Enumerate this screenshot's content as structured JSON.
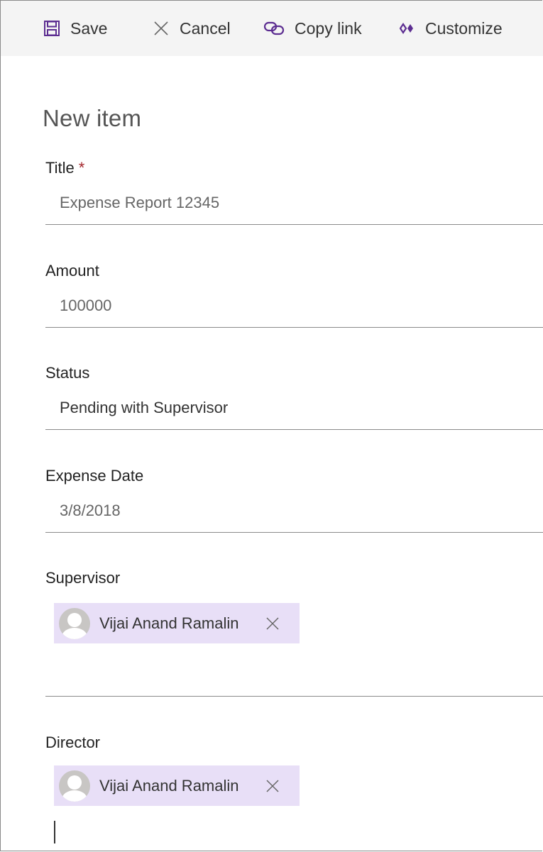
{
  "toolbar": {
    "save_label": "Save",
    "cancel_label": "Cancel",
    "copy_link_label": "Copy link",
    "customize_label": "Customize"
  },
  "form": {
    "heading": "New item",
    "fields": {
      "title": {
        "label": "Title",
        "required_marker": "*",
        "value": "Expense Report 12345"
      },
      "amount": {
        "label": "Amount",
        "value": "100000"
      },
      "status": {
        "label": "Status",
        "value": "Pending with Supervisor"
      },
      "expense_date": {
        "label": "Expense Date",
        "value": "3/8/2018"
      },
      "supervisor": {
        "label": "Supervisor",
        "person": "Vijai Anand Ramalin"
      },
      "director": {
        "label": "Director",
        "person": "Vijai Anand Ramalin"
      }
    }
  },
  "colors": {
    "accent": "#5c2d91",
    "persona_bg": "#e8dff7",
    "required": "#a4262c",
    "toolbar_bg": "#f4f4f4"
  },
  "icons": {
    "save": "save-icon",
    "cancel": "close-icon",
    "copy_link": "link-icon",
    "customize": "customize-icon",
    "avatar": "person-icon",
    "remove": "close-icon"
  }
}
